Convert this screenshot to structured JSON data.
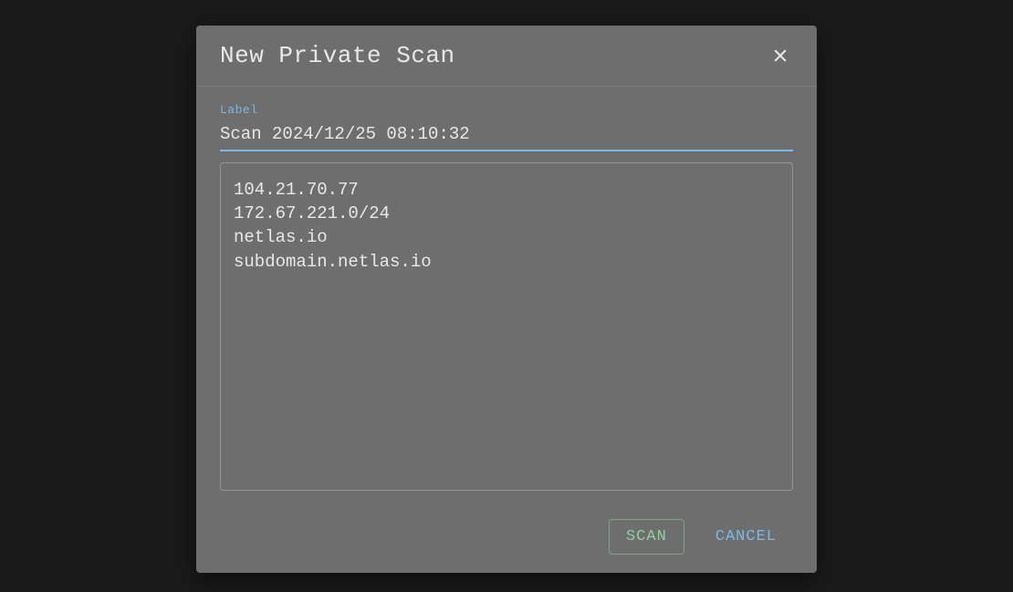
{
  "dialog": {
    "title": "New Private Scan",
    "label_field": {
      "label": "Label",
      "value": "Scan 2024/12/25 08:10:32"
    },
    "targets": "104.21.70.77\n172.67.221.0/24\nnetlas.io\nsubdomain.netlas.io",
    "buttons": {
      "scan": "SCAN",
      "cancel": "CANCEL"
    }
  }
}
